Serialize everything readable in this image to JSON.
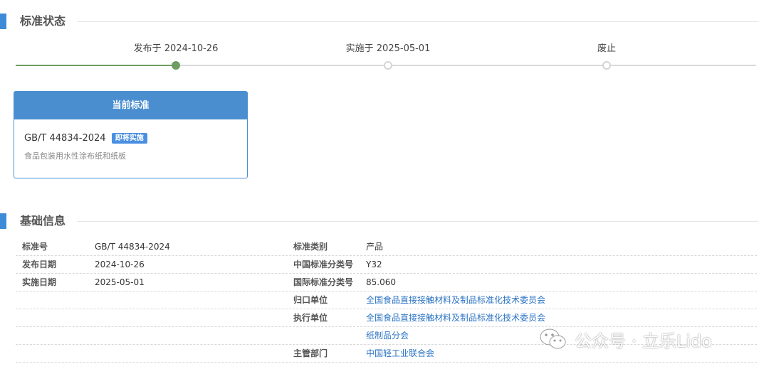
{
  "status_section": {
    "title": "标准状态",
    "timeline": [
      {
        "label": "发布于 2024-10-26",
        "state": "done"
      },
      {
        "label": "实施于 2025-05-01",
        "state": "pending"
      },
      {
        "label": "废止",
        "state": "pending"
      }
    ]
  },
  "current_card": {
    "header": "当前标准",
    "code": "GB/T 44834-2024",
    "badge": "即将实施",
    "name": "食品包装用水性涂布纸和纸板"
  },
  "basic_section": {
    "title": "基础信息",
    "rows": [
      {
        "k1": "标准号",
        "v1": "GB/T 44834-2024",
        "k2": "标准类别",
        "v2": "产品",
        "v2_link": false
      },
      {
        "k1": "发布日期",
        "v1": "2024-10-26",
        "k2": "中国标准分类号",
        "v2": "Y32",
        "v2_link": false
      },
      {
        "k1": "实施日期",
        "v1": "2025-05-01",
        "k2": "国际标准分类号",
        "v2": "85.060",
        "v2_link": false
      },
      {
        "k1": "",
        "v1": "",
        "k2": "归口单位",
        "v2": "全国食品直接接触材料及制品标准化技术委员会",
        "v2_link": true
      },
      {
        "k1": "",
        "v1": "",
        "k2": "执行单位",
        "v2": "全国食品直接接触材料及制品标准化技术委员会",
        "v2_link": true
      },
      {
        "k1": "",
        "v1": "",
        "k2": "",
        "v2": "纸制品分会",
        "v2_link": true
      },
      {
        "k1": "",
        "v1": "",
        "k2": "主管部门",
        "v2": "中国轻工业联合会",
        "v2_link": true
      }
    ]
  },
  "watermark": {
    "text": "公众号 · 立乐Lido",
    "icon": "wechat-icon"
  },
  "colors": {
    "accent": "#4a8ed0",
    "progress": "#6f9c62",
    "link": "#2a73c4"
  }
}
